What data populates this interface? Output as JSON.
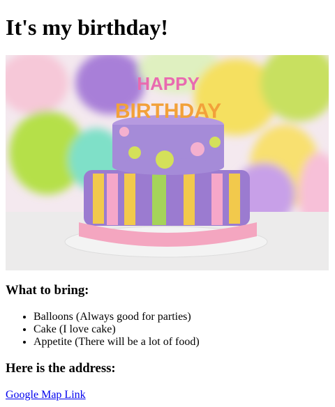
{
  "title": "It's my birthday!",
  "image": {
    "alt": "Birthday cake",
    "candle_text": "HAPPY BIRTHDAY"
  },
  "bring": {
    "heading": "What to bring:",
    "items": [
      "Balloons (Always good for parties)",
      "Cake (I love cake)",
      "Appetite (There will be a lot of food)"
    ]
  },
  "address": {
    "heading": "Here is the address:",
    "link_label": "Google Map Link"
  }
}
